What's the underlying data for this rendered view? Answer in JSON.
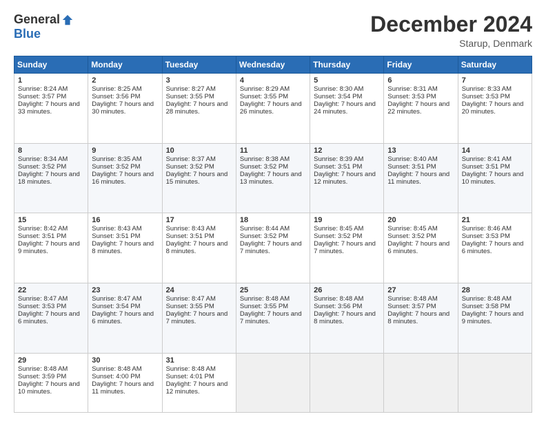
{
  "logo": {
    "general": "General",
    "blue": "Blue"
  },
  "header": {
    "title": "December 2024",
    "location": "Starup, Denmark"
  },
  "days_of_week": [
    "Sunday",
    "Monday",
    "Tuesday",
    "Wednesday",
    "Thursday",
    "Friday",
    "Saturday"
  ],
  "weeks": [
    [
      {
        "day": "1",
        "sunrise": "Sunrise: 8:24 AM",
        "sunset": "Sunset: 3:57 PM",
        "daylight": "Daylight: 7 hours and 33 minutes."
      },
      {
        "day": "2",
        "sunrise": "Sunrise: 8:25 AM",
        "sunset": "Sunset: 3:56 PM",
        "daylight": "Daylight: 7 hours and 30 minutes."
      },
      {
        "day": "3",
        "sunrise": "Sunrise: 8:27 AM",
        "sunset": "Sunset: 3:55 PM",
        "daylight": "Daylight: 7 hours and 28 minutes."
      },
      {
        "day": "4",
        "sunrise": "Sunrise: 8:29 AM",
        "sunset": "Sunset: 3:55 PM",
        "daylight": "Daylight: 7 hours and 26 minutes."
      },
      {
        "day": "5",
        "sunrise": "Sunrise: 8:30 AM",
        "sunset": "Sunset: 3:54 PM",
        "daylight": "Daylight: 7 hours and 24 minutes."
      },
      {
        "day": "6",
        "sunrise": "Sunrise: 8:31 AM",
        "sunset": "Sunset: 3:53 PM",
        "daylight": "Daylight: 7 hours and 22 minutes."
      },
      {
        "day": "7",
        "sunrise": "Sunrise: 8:33 AM",
        "sunset": "Sunset: 3:53 PM",
        "daylight": "Daylight: 7 hours and 20 minutes."
      }
    ],
    [
      {
        "day": "8",
        "sunrise": "Sunrise: 8:34 AM",
        "sunset": "Sunset: 3:52 PM",
        "daylight": "Daylight: 7 hours and 18 minutes."
      },
      {
        "day": "9",
        "sunrise": "Sunrise: 8:35 AM",
        "sunset": "Sunset: 3:52 PM",
        "daylight": "Daylight: 7 hours and 16 minutes."
      },
      {
        "day": "10",
        "sunrise": "Sunrise: 8:37 AM",
        "sunset": "Sunset: 3:52 PM",
        "daylight": "Daylight: 7 hours and 15 minutes."
      },
      {
        "day": "11",
        "sunrise": "Sunrise: 8:38 AM",
        "sunset": "Sunset: 3:52 PM",
        "daylight": "Daylight: 7 hours and 13 minutes."
      },
      {
        "day": "12",
        "sunrise": "Sunrise: 8:39 AM",
        "sunset": "Sunset: 3:51 PM",
        "daylight": "Daylight: 7 hours and 12 minutes."
      },
      {
        "day": "13",
        "sunrise": "Sunrise: 8:40 AM",
        "sunset": "Sunset: 3:51 PM",
        "daylight": "Daylight: 7 hours and 11 minutes."
      },
      {
        "day": "14",
        "sunrise": "Sunrise: 8:41 AM",
        "sunset": "Sunset: 3:51 PM",
        "daylight": "Daylight: 7 hours and 10 minutes."
      }
    ],
    [
      {
        "day": "15",
        "sunrise": "Sunrise: 8:42 AM",
        "sunset": "Sunset: 3:51 PM",
        "daylight": "Daylight: 7 hours and 9 minutes."
      },
      {
        "day": "16",
        "sunrise": "Sunrise: 8:43 AM",
        "sunset": "Sunset: 3:51 PM",
        "daylight": "Daylight: 7 hours and 8 minutes."
      },
      {
        "day": "17",
        "sunrise": "Sunrise: 8:43 AM",
        "sunset": "Sunset: 3:51 PM",
        "daylight": "Daylight: 7 hours and 8 minutes."
      },
      {
        "day": "18",
        "sunrise": "Sunrise: 8:44 AM",
        "sunset": "Sunset: 3:52 PM",
        "daylight": "Daylight: 7 hours and 7 minutes."
      },
      {
        "day": "19",
        "sunrise": "Sunrise: 8:45 AM",
        "sunset": "Sunset: 3:52 PM",
        "daylight": "Daylight: 7 hours and 7 minutes."
      },
      {
        "day": "20",
        "sunrise": "Sunrise: 8:45 AM",
        "sunset": "Sunset: 3:52 PM",
        "daylight": "Daylight: 7 hours and 6 minutes."
      },
      {
        "day": "21",
        "sunrise": "Sunrise: 8:46 AM",
        "sunset": "Sunset: 3:53 PM",
        "daylight": "Daylight: 7 hours and 6 minutes."
      }
    ],
    [
      {
        "day": "22",
        "sunrise": "Sunrise: 8:47 AM",
        "sunset": "Sunset: 3:53 PM",
        "daylight": "Daylight: 7 hours and 6 minutes."
      },
      {
        "day": "23",
        "sunrise": "Sunrise: 8:47 AM",
        "sunset": "Sunset: 3:54 PM",
        "daylight": "Daylight: 7 hours and 6 minutes."
      },
      {
        "day": "24",
        "sunrise": "Sunrise: 8:47 AM",
        "sunset": "Sunset: 3:55 PM",
        "daylight": "Daylight: 7 hours and 7 minutes."
      },
      {
        "day": "25",
        "sunrise": "Sunrise: 8:48 AM",
        "sunset": "Sunset: 3:55 PM",
        "daylight": "Daylight: 7 hours and 7 minutes."
      },
      {
        "day": "26",
        "sunrise": "Sunrise: 8:48 AM",
        "sunset": "Sunset: 3:56 PM",
        "daylight": "Daylight: 7 hours and 8 minutes."
      },
      {
        "day": "27",
        "sunrise": "Sunrise: 8:48 AM",
        "sunset": "Sunset: 3:57 PM",
        "daylight": "Daylight: 7 hours and 8 minutes."
      },
      {
        "day": "28",
        "sunrise": "Sunrise: 8:48 AM",
        "sunset": "Sunset: 3:58 PM",
        "daylight": "Daylight: 7 hours and 9 minutes."
      }
    ],
    [
      {
        "day": "29",
        "sunrise": "Sunrise: 8:48 AM",
        "sunset": "Sunset: 3:59 PM",
        "daylight": "Daylight: 7 hours and 10 minutes."
      },
      {
        "day": "30",
        "sunrise": "Sunrise: 8:48 AM",
        "sunset": "Sunset: 4:00 PM",
        "daylight": "Daylight: 7 hours and 11 minutes."
      },
      {
        "day": "31",
        "sunrise": "Sunrise: 8:48 AM",
        "sunset": "Sunset: 4:01 PM",
        "daylight": "Daylight: 7 hours and 12 minutes."
      },
      null,
      null,
      null,
      null
    ]
  ]
}
